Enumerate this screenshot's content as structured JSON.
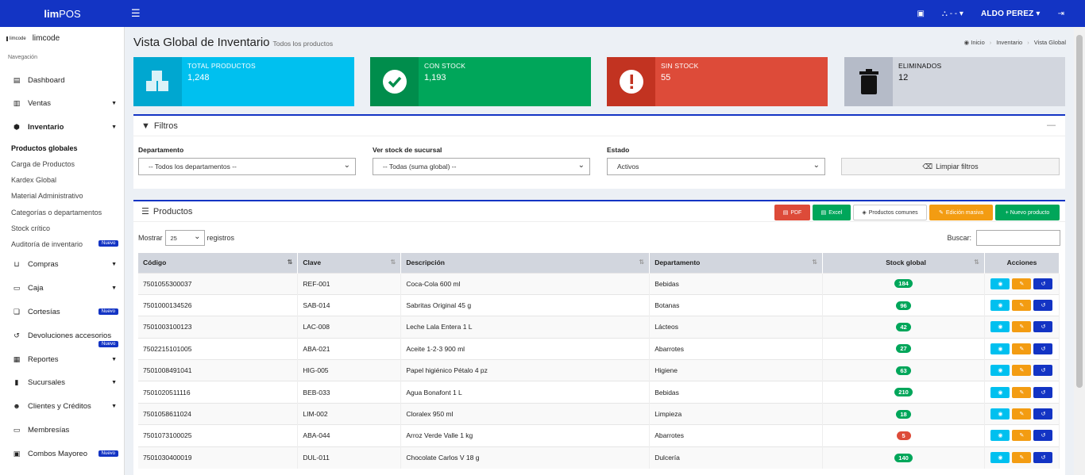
{
  "app": {
    "brand_bold": "lim",
    "brand_rest": "POS",
    "user": "ALDO PEREZ"
  },
  "colors": {
    "accent": "#1334c4",
    "cyan": "#00c0ef",
    "green": "#00a65a",
    "red": "#dd4b39",
    "gray": "#d2d6de",
    "orange": "#f39c12"
  },
  "topbar": {
    "branch_label": "- -"
  },
  "sidebar": {
    "brand_mini": "limcode",
    "brand": "limcode",
    "nav_header": "Navegación",
    "items": {
      "dashboard": "Dashboard",
      "ventas": "Ventas",
      "inventario": "Inventario",
      "compras": "Compras",
      "caja": "Caja",
      "cortesias": "Cortesías",
      "devoluciones": "Devoluciones accesorios",
      "reportes": "Reportes",
      "sucursales": "Sucursales",
      "clientes": "Clientes y Créditos",
      "membresias": "Membresías",
      "combos": "Combos Mayoreo"
    },
    "sub": {
      "productos_globales": "Productos globales",
      "carga": "Carga de Productos",
      "kardex": "Kardex Global",
      "material": "Material Administrativo",
      "categorias": "Categorías o departamentos",
      "stock_critico": "Stock crítico",
      "auditoria": "Auditoría de inventario"
    },
    "badge": "Nuevo"
  },
  "page": {
    "title": "Vista Global de Inventario",
    "subtitle": "Todos los productos",
    "crumbs": [
      "Inicio",
      "Inventario",
      "Vista Global"
    ]
  },
  "stats": [
    {
      "label": "TOTAL PRODUCTOS",
      "value": "1,248"
    },
    {
      "label": "CON STOCK",
      "value": "1,193"
    },
    {
      "label": "SIN STOCK",
      "value": "55"
    },
    {
      "label": "ELIMINADOS",
      "value": "12"
    }
  ],
  "filters": {
    "title": "Filtros",
    "dept_label": "Departamento",
    "dept_value": "-- Todos los departamentos --",
    "branch_label": "Ver stock de sucursal",
    "branch_value": "-- Todas (suma global) --",
    "state_label": "Estado",
    "state_value": "Activos",
    "clear": "Limpiar filtros"
  },
  "products": {
    "title": "Productos",
    "buttons": {
      "pdf": "PDF",
      "excel": "Excel",
      "common": "Productos comunes",
      "mass": "Edición masiva",
      "new": "+ Nuevo producto"
    },
    "show": "Mostrar",
    "show_value": "25",
    "records": "registros",
    "search": "Buscar:",
    "columns": [
      "Código",
      "Clave",
      "Descripción",
      "Departamento",
      "Stock global",
      "Acciones"
    ],
    "rows": [
      {
        "code": "7501055300037",
        "key": "REF-001",
        "desc": "Coca-Cola 600 ml",
        "dept": "Bebidas",
        "stock": "184",
        "color": "#00a65a"
      },
      {
        "code": "7501000134526",
        "key": "SAB-014",
        "desc": "Sabritas Original 45 g",
        "dept": "Botanas",
        "stock": "96",
        "color": "#00a65a"
      },
      {
        "code": "7501003100123",
        "key": "LAC-008",
        "desc": "Leche Lala Entera 1 L",
        "dept": "Lácteos",
        "stock": "42",
        "color": "#00a65a"
      },
      {
        "code": "7502215101005",
        "key": "ABA-021",
        "desc": "Aceite 1-2-3 900 ml",
        "dept": "Abarrotes",
        "stock": "27",
        "color": "#00a65a"
      },
      {
        "code": "7501008491041",
        "key": "HIG-005",
        "desc": "Papel higiénico Pétalo 4 pz",
        "dept": "Higiene",
        "stock": "63",
        "color": "#00a65a"
      },
      {
        "code": "7501020511116",
        "key": "BEB-033",
        "desc": "Agua Bonafont 1 L",
        "dept": "Bebidas",
        "stock": "210",
        "color": "#00a65a"
      },
      {
        "code": "7501058611024",
        "key": "LIM-002",
        "desc": "Cloralex 950 ml",
        "dept": "Limpieza",
        "stock": "18",
        "color": "#00a65a"
      },
      {
        "code": "7501073100025",
        "key": "ABA-044",
        "desc": "Arroz Verde Valle 1 kg",
        "dept": "Abarrotes",
        "stock": "5",
        "color": "#dd4b39"
      },
      {
        "code": "7501030400019",
        "key": "DUL-011",
        "desc": "Chocolate Carlos V 18 g",
        "dept": "Dulcería",
        "stock": "140",
        "color": "#00a65a"
      }
    ]
  }
}
